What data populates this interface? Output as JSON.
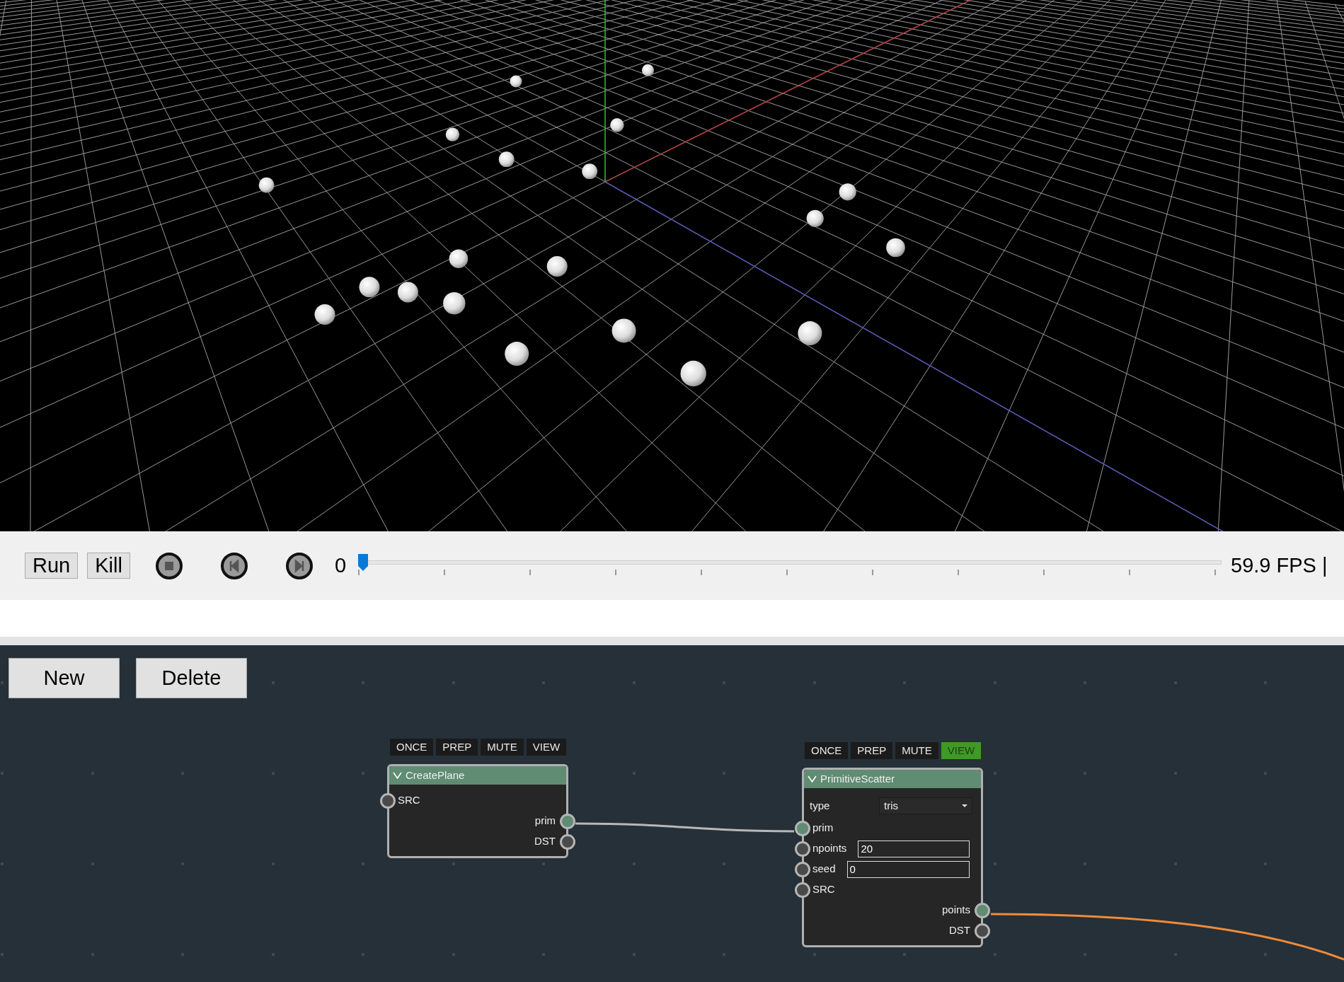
{
  "toolbar": {
    "buttons": [
      "Run",
      "Kill"
    ],
    "transport": [
      {
        "kind": "stop"
      },
      {
        "kind": "prev"
      },
      {
        "kind": "next"
      }
    ],
    "frame": "0",
    "timeline": {
      "level": 0
    },
    "fps": "59.9 FPS |"
  },
  "node_editor": {
    "buttons": [
      "New",
      "Delete"
    ],
    "nodes": [
      {
        "title": "CreatePlane",
        "expanded": true,
        "flags": [
          {
            "label": "ONCE",
            "on": false
          },
          {
            "label": "PREP",
            "on": false
          },
          {
            "label": "MUTE",
            "on": false
          },
          {
            "label": "VIEW",
            "on": false
          }
        ],
        "inputs": [
          {
            "name": "SRC",
            "connected": false
          }
        ],
        "outputs": [
          {
            "name": "prim",
            "connected": true
          },
          {
            "name": "DST",
            "connected": false
          }
        ]
      },
      {
        "title": "PrimitiveScatter",
        "expanded": true,
        "flags": [
          {
            "label": "ONCE",
            "on": false
          },
          {
            "label": "PREP",
            "on": false
          },
          {
            "label": "MUTE",
            "on": false
          },
          {
            "label": "VIEW",
            "on": true
          }
        ],
        "params": [
          {
            "label": "type",
            "kind": "dropdown",
            "value": "tris"
          }
        ],
        "inputs": [
          {
            "name": "prim",
            "connected": true
          },
          {
            "name": "npoints",
            "connected": false,
            "value": "20"
          },
          {
            "name": "seed",
            "connected": false,
            "value": "0"
          },
          {
            "name": "SRC",
            "connected": false
          }
        ],
        "outputs": [
          {
            "name": "points",
            "connected": true
          },
          {
            "name": "DST",
            "connected": false
          }
        ]
      }
    ]
  }
}
